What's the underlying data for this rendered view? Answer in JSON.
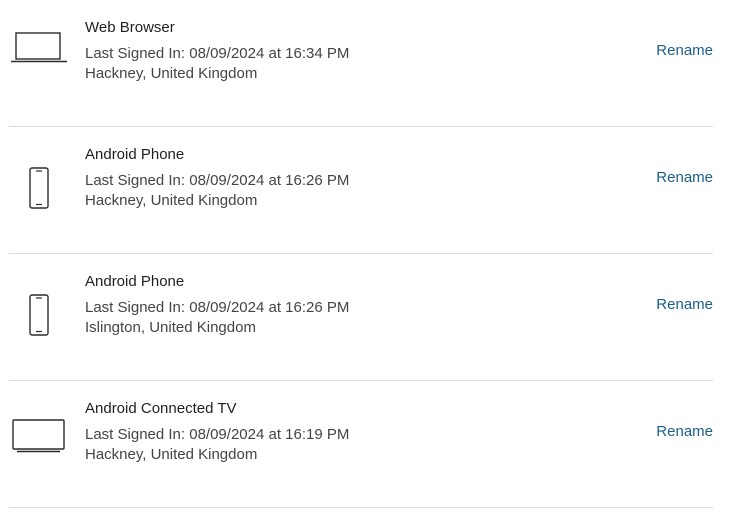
{
  "devices": [
    {
      "icon": "laptop-icon",
      "name": "Web Browser",
      "last_signed_in": "Last Signed In: 08/09/2024 at 16:34 PM",
      "location": "Hackney, United Kingdom",
      "action_label": "Rename"
    },
    {
      "icon": "phone-icon",
      "name": "Android Phone",
      "last_signed_in": "Last Signed In: 08/09/2024 at 16:26 PM",
      "location": "Hackney, United Kingdom",
      "action_label": "Rename"
    },
    {
      "icon": "phone-icon",
      "name": "Android Phone",
      "last_signed_in": "Last Signed In: 08/09/2024 at 16:26 PM",
      "location": "Islington, United Kingdom",
      "action_label": "Rename"
    },
    {
      "icon": "tv-icon",
      "name": "Android Connected TV",
      "last_signed_in": "Last Signed In: 08/09/2024 at 16:19 PM",
      "location": "Hackney, United Kingdom",
      "action_label": "Rename"
    }
  ],
  "colors": {
    "link": "#1b5e8a",
    "divider": "#dcdcdc",
    "text": "#444444"
  }
}
